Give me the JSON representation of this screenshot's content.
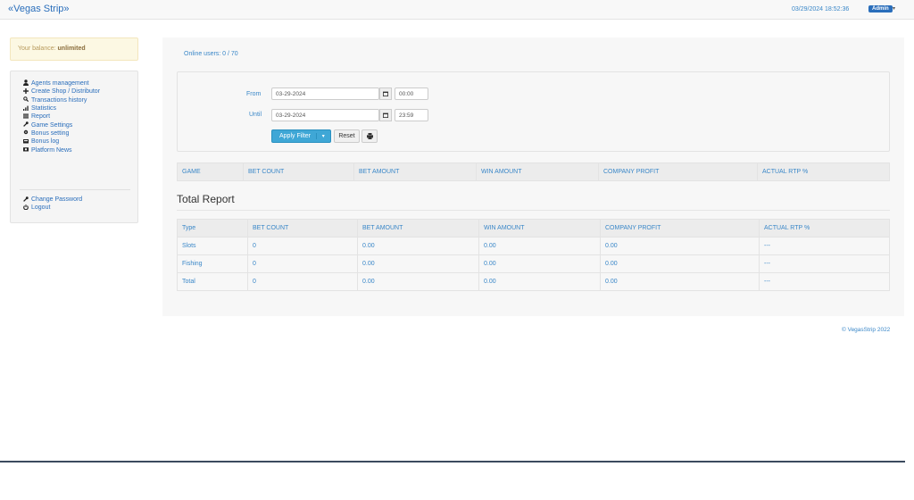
{
  "header": {
    "brand": "«Vegas Strip»",
    "datetime": "03/29/2024 18:52:36",
    "user_badge": "Admin",
    "caret": "▾"
  },
  "balance": {
    "label": "Your balance:",
    "value": "unlimited"
  },
  "sidebar": {
    "items": [
      {
        "label": "Agents management",
        "icon": "user-icon"
      },
      {
        "label": "Create Shop / Distributor",
        "icon": "plus-icon"
      },
      {
        "label": "Transactions history",
        "icon": "search-icon"
      },
      {
        "label": "Statistics",
        "icon": "signal-icon"
      },
      {
        "label": "Report",
        "icon": "list-icon"
      },
      {
        "label": "Game Settings",
        "icon": "wrench-icon"
      },
      {
        "label": "Bonus setting",
        "icon": "gear-icon"
      },
      {
        "label": "Bonus log",
        "icon": "inbox-icon"
      },
      {
        "label": "Platform News",
        "icon": "camera-icon"
      }
    ],
    "bottom_items": [
      {
        "label": "Change Password",
        "icon": "wrench-icon"
      },
      {
        "label": "Logout",
        "icon": "power-icon"
      }
    ]
  },
  "main": {
    "online_users": "Online users: 0 / 70",
    "filter": {
      "from_label": "From",
      "from_date": "03-29-2024",
      "from_time": "00:00",
      "until_label": "Until",
      "until_date": "03-29-2024",
      "until_time": "23:59",
      "apply_label": "Apply Filter",
      "reset_label": "Reset"
    },
    "game_table": {
      "headers": [
        "GAME",
        "BET COUNT",
        "BET AMOUNT",
        "WIN AMOUNT",
        "COMPANY PROFIT",
        "ACTUAL RTP %"
      ]
    },
    "total_report": {
      "title": "Total Report",
      "headers": [
        "Type",
        "BET COUNT",
        "BET AMOUNT",
        "WIN AMOUNT",
        "COMPANY PROFIT",
        "ACTUAL RTP %"
      ],
      "rows": [
        [
          "Slots",
          "0",
          "0.00",
          "0.00",
          "0.00",
          "---"
        ],
        [
          "Fishing",
          "0",
          "0.00",
          "0.00",
          "0.00",
          "---"
        ],
        [
          "Total",
          "0",
          "0.00",
          "0.00",
          "0.00",
          "---"
        ]
      ]
    }
  },
  "footer": {
    "copyright": "© VegasStrip 2022"
  }
}
